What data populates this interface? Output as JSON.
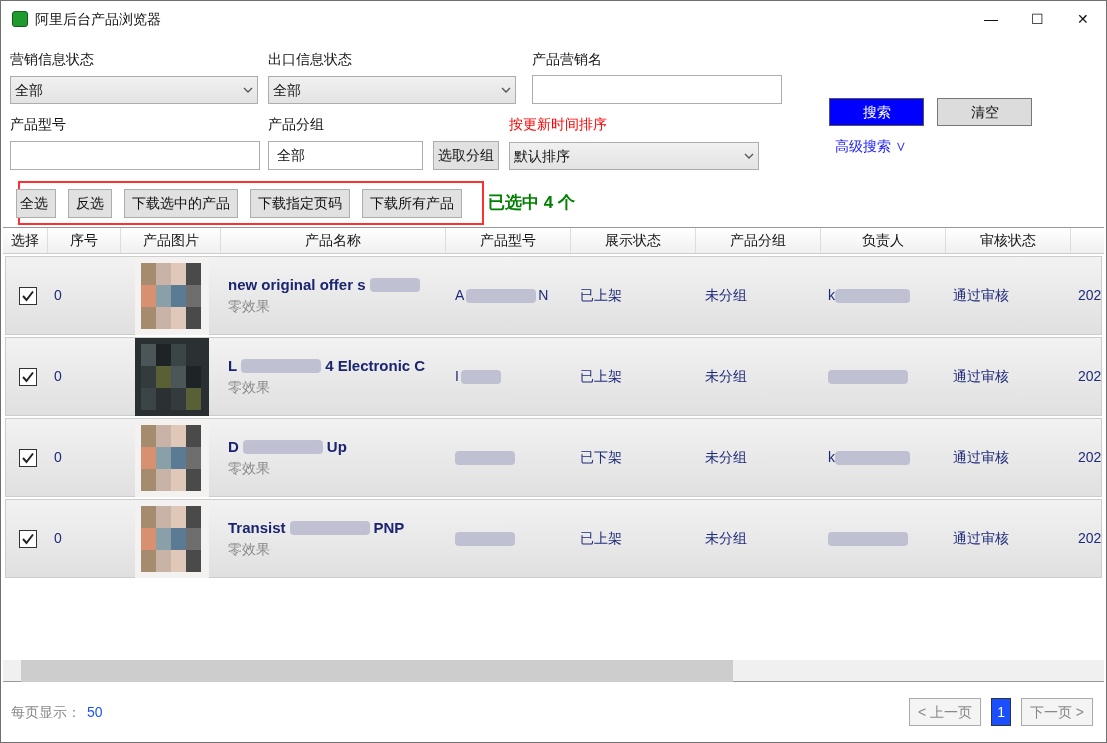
{
  "window": {
    "title": "阿里后台产品浏览器",
    "controls": [
      "—",
      "☐",
      "✕"
    ]
  },
  "filters": {
    "marketing_status": {
      "label": "营销信息状态",
      "value": "全部"
    },
    "export_status": {
      "label": "出口信息状态",
      "value": "全部"
    },
    "marketing_name": {
      "label": "产品营销名"
    },
    "model": {
      "label": "产品型号"
    },
    "group": {
      "label": "产品分组",
      "value": "全部",
      "button": "选取分组"
    },
    "sort": {
      "label": "按更新时间排序",
      "value": "默认排序"
    },
    "search_button": "搜索",
    "clear_button": "清空",
    "advanced_search": "高级搜索 ∨"
  },
  "toolbar": {
    "buttons": [
      "全选",
      "反选",
      "下载选中的产品",
      "下载指定页码",
      "下载所有产品"
    ],
    "selected_count": "已选中 4 个"
  },
  "table": {
    "columns": [
      "选择",
      "序号",
      "产品图片",
      "产品名称",
      "产品型号",
      "展示状态",
      "产品分组",
      "负责人",
      "审核状态"
    ],
    "rows": [
      {
        "checked": true,
        "index": "0",
        "name": [
          "new original offer s"
        ],
        "subtitle": "零效果",
        "model": [
          "A",
          "N"
        ],
        "display_status": "已上架",
        "group": "未分组",
        "owner": "k",
        "review": "通过审核",
        "date": "202"
      },
      {
        "checked": true,
        "index": "0",
        "name": [
          "L",
          "4 Electronic C"
        ],
        "subtitle": "零效果",
        "model": [
          "I"
        ],
        "display_status": "已上架",
        "group": "未分组",
        "owner": "",
        "review": "通过审核",
        "date": "202"
      },
      {
        "checked": true,
        "index": "0",
        "name": [
          "D",
          "Up"
        ],
        "subtitle": "零效果",
        "model": [],
        "display_status": "已下架",
        "group": "未分组",
        "owner": "k",
        "review": "通过审核",
        "date": "202"
      },
      {
        "checked": true,
        "index": "0",
        "name": [
          "Transist",
          "PNP"
        ],
        "subtitle": "零效果",
        "model": [],
        "display_status": "已上架",
        "group": "未分组",
        "owner": "",
        "review": "通过审核",
        "date": "202"
      }
    ]
  },
  "footer": {
    "page_size_label": "每页显示：",
    "page_size": "50",
    "prev": "< 上一页",
    "pages": [
      {
        "label": "1",
        "selected": true
      }
    ],
    "next": "下一页 >"
  }
}
